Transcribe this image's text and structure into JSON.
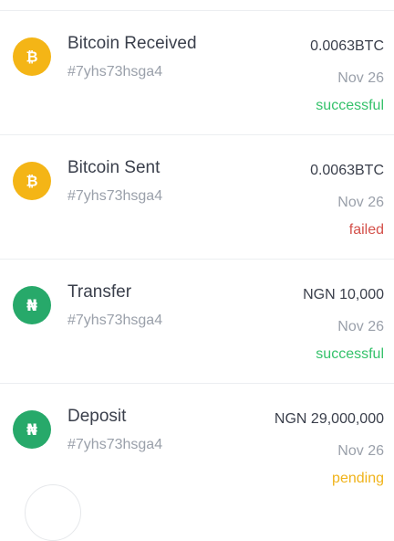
{
  "transactions": [
    {
      "title": "Bitcoin Received",
      "reference": "#7yhs73hsga4",
      "amount": "0.0063BTC",
      "date": "Nov 26",
      "status": "successful",
      "status_color": "#35c26b",
      "icon": "bitcoin-icon",
      "icon_bg": "#f4b516"
    },
    {
      "title": "Bitcoin Sent",
      "reference": "#7yhs73hsga4",
      "amount": "0.0063BTC",
      "date": "Nov 26",
      "status": "failed",
      "status_color": "#d4504a",
      "icon": "bitcoin-icon",
      "icon_bg": "#f4b516"
    },
    {
      "title": "Transfer",
      "reference": "#7yhs73hsga4",
      "amount": "NGN 10,000",
      "date": "Nov 26",
      "status": "successful",
      "status_color": "#35c26b",
      "icon": "naira-icon",
      "icon_bg": "#27a96a"
    },
    {
      "title": "Deposit",
      "reference": "#7yhs73hsga4",
      "amount": "NGN 29,000,000",
      "date": "Nov 26",
      "status": "pending",
      "status_color": "#f0b31a",
      "icon": "naira-icon",
      "icon_bg": "#27a96a"
    }
  ]
}
